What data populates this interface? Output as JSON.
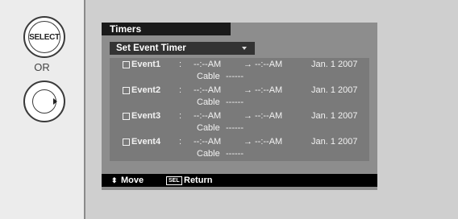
{
  "side": {
    "select_label": "SELECT",
    "or_label": "OR"
  },
  "menu": {
    "title": "Timers",
    "subtitle": "Set Event Timer",
    "events": [
      {
        "name": "Event1",
        "colon": ":",
        "start": "--:--AM",
        "arrow": "→",
        "end": "--:--AM",
        "date": "Jan. 1 2007",
        "source": "Cable",
        "channel": "------"
      },
      {
        "name": "Event2",
        "colon": ":",
        "start": "--:--AM",
        "arrow": "→",
        "end": "--:--AM",
        "date": "Jan. 1 2007",
        "source": "Cable",
        "channel": "------"
      },
      {
        "name": "Event3",
        "colon": ":",
        "start": "--:--AM",
        "arrow": "→",
        "end": "--:--AM",
        "date": "Jan. 1 2007",
        "source": "Cable",
        "channel": "------"
      },
      {
        "name": "Event4",
        "colon": ":",
        "start": "--:--AM",
        "arrow": "→",
        "end": "--:--AM",
        "date": "Jan. 1 2007",
        "source": "Cable",
        "channel": "------"
      }
    ]
  },
  "footer": {
    "updown": "⬍",
    "move_label": "Move",
    "sel_badge": "SEL",
    "return_label": "Return"
  }
}
